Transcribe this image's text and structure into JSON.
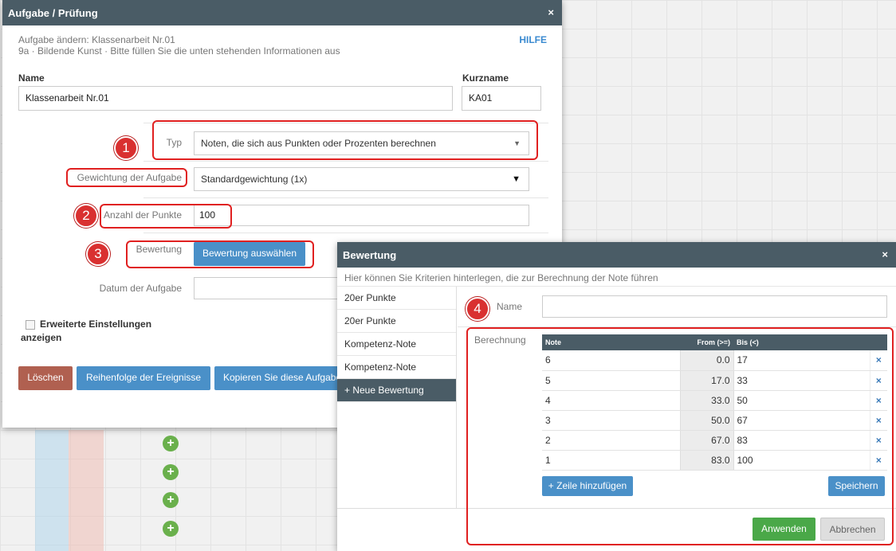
{
  "dialog_main": {
    "title": "Aufgabe / Prüfung",
    "close": "×",
    "subtitle1": "Aufgabe ändern: Klassenarbeit Nr.01",
    "subtitle2": "9a · Bildende Kunst · Bitte füllen Sie die unten stehenden Informationen aus",
    "help": "HILFE",
    "name_label": "Name",
    "name_value": "Klassenarbeit Nr.01",
    "shortname_label": "Kurzname",
    "shortname_value": "KA01",
    "type_label": "Typ",
    "type_value": "Noten, die sich aus Punkten oder Prozenten berechnen",
    "weight_label": "Gewichtung der Aufgabe",
    "weight_value": "Standardgewichtung (1x)",
    "points_label": "Anzahl der Punkte",
    "points_value": "100",
    "rating_label": "Bewertung",
    "rating_button": "Bewertung auswählen",
    "date_label": "Datum der Aufgabe",
    "advanced_label_1": "Erweiterte Einstellungen",
    "advanced_label_2": "anzeigen",
    "delete_button": "Löschen",
    "order_button": "Reihenfolge der Ereignisse",
    "copy_button": "Kopieren Sie diese Aufgabe"
  },
  "annotations": [
    "1",
    "2",
    "3",
    "4"
  ],
  "dialog_rating": {
    "title": "Bewertung",
    "close": "×",
    "hint": "Hier können Sie Kriterien hinterlegen, die zur Berechnung der Note führen",
    "sidebar": [
      "20er Punkte",
      "20er Punkte",
      "Kompetenz-Note",
      "Kompetenz-Note",
      "+ Neue Bewertung"
    ],
    "name_label": "Name",
    "name_value": "",
    "calc_label": "Berechnung",
    "columns": [
      "Note",
      "From (>=)",
      "Bis (<)"
    ],
    "rows": [
      {
        "note": "6",
        "from": "0.0",
        "bis": "17"
      },
      {
        "note": "5",
        "from": "17.0",
        "bis": "33"
      },
      {
        "note": "4",
        "from": "33.0",
        "bis": "50"
      },
      {
        "note": "3",
        "from": "50.0",
        "bis": "67"
      },
      {
        "note": "2",
        "from": "67.0",
        "bis": "83"
      },
      {
        "note": "1",
        "from": "83.0",
        "bis": "100"
      }
    ],
    "delete_icon": "×",
    "add_row_button": "+ Zeile hinzufügen",
    "save_button": "Speichern",
    "apply_button": "Anwenden",
    "cancel_button": "Abbrechen"
  },
  "colors": {
    "titlebar": "#4a5c66",
    "accent_blue": "#4a90c8",
    "annotation_red": "#e02020",
    "apply_green": "#4aa848",
    "delete_red": "#b06050"
  }
}
